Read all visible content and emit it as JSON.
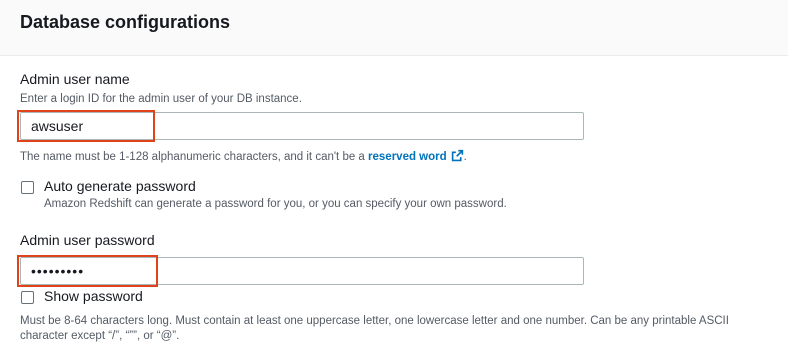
{
  "section": {
    "title": "Database configurations"
  },
  "admin_user": {
    "label": "Admin user name",
    "description": "Enter a login ID for the admin user of your DB instance.",
    "value": "awsuser",
    "hint_prefix": "The name must be 1-128 alphanumeric characters, and it can't be a ",
    "hint_link": "reserved word",
    "hint_suffix": "."
  },
  "auto_generate": {
    "label": "Auto generate password",
    "description": "Amazon Redshift can generate a password for you, or you can specify your own password.",
    "checked": false
  },
  "admin_password": {
    "label": "Admin user password",
    "value": "•••••••••",
    "show_password_label": "Show password",
    "show_password_checked": false,
    "hint": "Must be 8-64 characters long. Must contain at least one uppercase letter, one lowercase letter and one number. Can be any printable ASCII character except “/”, “””, or “@”."
  },
  "colors": {
    "highlight": "#e0431c",
    "link": "#0073bb"
  },
  "icons": {
    "external_link": "external-link-icon"
  }
}
